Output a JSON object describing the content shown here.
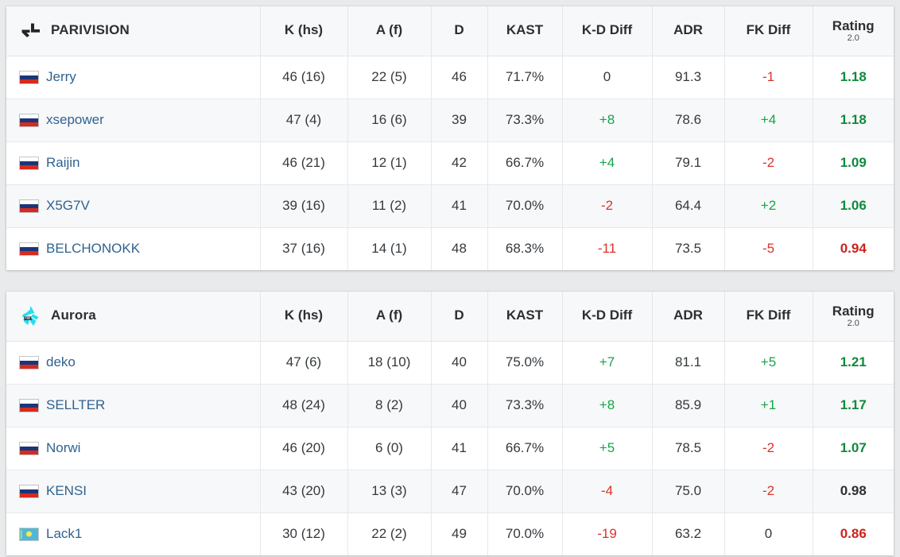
{
  "columns": [
    {
      "key": "player",
      "label": "",
      "cls": "c-player"
    },
    {
      "key": "k",
      "label": "K (hs)",
      "cls": "c-k"
    },
    {
      "key": "a",
      "label": "A (f)",
      "cls": "c-a"
    },
    {
      "key": "d",
      "label": "D",
      "cls": "c-d"
    },
    {
      "key": "kast",
      "label": "KAST",
      "cls": "c-kast"
    },
    {
      "key": "kd",
      "label": "K-D Diff",
      "cls": "c-kd"
    },
    {
      "key": "adr",
      "label": "ADR",
      "cls": "c-adr"
    },
    {
      "key": "fk",
      "label": "FK Diff",
      "cls": "c-fk"
    },
    {
      "key": "rating",
      "label": "Rating",
      "sub": "2.0",
      "cls": "c-rating"
    }
  ],
  "colors": {
    "positive": "#18a34a",
    "negative": "#d9342b",
    "neutral": "#35393d",
    "rating_good": "#108a3c",
    "rating_mid": "#2c2f33",
    "rating_bad": "#cc231b",
    "link": "#30628f",
    "page_background": "#e8eaec",
    "card_background": "#ffffff",
    "header_background": "#f7f8f9",
    "row_alt_background": "#f7f8f9",
    "aurora_logo": "#1fe0ef",
    "parivision_logo": "#22262b"
  },
  "teams": [
    {
      "name": "PARIVISION",
      "logo": "parivision-logo",
      "players": [
        {
          "name": "Jerry",
          "flag": "russia",
          "k": "46 (16)",
          "a": "22 (5)",
          "d": "46",
          "kast": "71.7%",
          "kd": "0",
          "kd_sign": "neu",
          "adr": "91.3",
          "fk": "-1",
          "fk_sign": "neg",
          "rating": "1.18",
          "rating_sign": "good"
        },
        {
          "name": "xsepower",
          "flag": "russia",
          "k": "47 (4)",
          "a": "16 (6)",
          "d": "39",
          "kast": "73.3%",
          "kd": "+8",
          "kd_sign": "pos",
          "adr": "78.6",
          "fk": "+4",
          "fk_sign": "pos",
          "rating": "1.18",
          "rating_sign": "good"
        },
        {
          "name": "Raijin",
          "flag": "russia",
          "k": "46 (21)",
          "a": "12 (1)",
          "d": "42",
          "kast": "66.7%",
          "kd": "+4",
          "kd_sign": "pos",
          "adr": "79.1",
          "fk": "-2",
          "fk_sign": "neg",
          "rating": "1.09",
          "rating_sign": "good"
        },
        {
          "name": "X5G7V",
          "flag": "russia",
          "k": "39 (16)",
          "a": "11 (2)",
          "d": "41",
          "kast": "70.0%",
          "kd": "-2",
          "kd_sign": "neg",
          "adr": "64.4",
          "fk": "+2",
          "fk_sign": "pos",
          "rating": "1.06",
          "rating_sign": "good"
        },
        {
          "name": "BELCHONOKK",
          "flag": "russia",
          "k": "37 (16)",
          "a": "14 (1)",
          "d": "48",
          "kast": "68.3%",
          "kd": "-11",
          "kd_sign": "neg",
          "adr": "73.5",
          "fk": "-5",
          "fk_sign": "neg",
          "rating": "0.94",
          "rating_sign": "bad"
        }
      ]
    },
    {
      "name": "Aurora",
      "logo": "aurora-logo",
      "players": [
        {
          "name": "deko",
          "flag": "russia",
          "k": "47 (6)",
          "a": "18 (10)",
          "d": "40",
          "kast": "75.0%",
          "kd": "+7",
          "kd_sign": "pos",
          "adr": "81.1",
          "fk": "+5",
          "fk_sign": "pos",
          "rating": "1.21",
          "rating_sign": "good"
        },
        {
          "name": "SELLTER",
          "flag": "russia",
          "k": "48 (24)",
          "a": "8 (2)",
          "d": "40",
          "kast": "73.3%",
          "kd": "+8",
          "kd_sign": "pos",
          "adr": "85.9",
          "fk": "+1",
          "fk_sign": "pos",
          "rating": "1.17",
          "rating_sign": "good"
        },
        {
          "name": "Norwi",
          "flag": "russia",
          "k": "46 (20)",
          "a": "6 (0)",
          "d": "41",
          "kast": "66.7%",
          "kd": "+5",
          "kd_sign": "pos",
          "adr": "78.5",
          "fk": "-2",
          "fk_sign": "neg",
          "rating": "1.07",
          "rating_sign": "good"
        },
        {
          "name": "KENSI",
          "flag": "russia",
          "k": "43 (20)",
          "a": "13 (3)",
          "d": "47",
          "kast": "70.0%",
          "kd": "-4",
          "kd_sign": "neg",
          "adr": "75.0",
          "fk": "-2",
          "fk_sign": "neg",
          "rating": "0.98",
          "rating_sign": "mid"
        },
        {
          "name": "Lack1",
          "flag": "kazakhstan",
          "k": "30 (12)",
          "a": "22 (2)",
          "d": "49",
          "kast": "70.0%",
          "kd": "-19",
          "kd_sign": "neg",
          "adr": "63.2",
          "fk": "0",
          "fk_sign": "neu",
          "rating": "0.86",
          "rating_sign": "bad"
        }
      ]
    }
  ]
}
